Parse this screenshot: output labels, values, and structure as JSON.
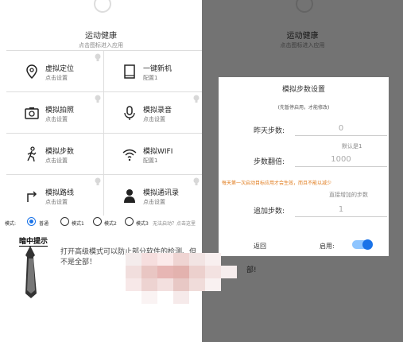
{
  "app": {
    "title": "运动健康",
    "subtitle": "点击图标进入应用"
  },
  "grid": [
    {
      "label": "虚拟定位",
      "status": "点击设置",
      "icon": "location-pin-icon"
    },
    {
      "label": "一键新机",
      "status": "配置1",
      "icon": "tablet-icon"
    },
    {
      "label": "模拟拍照",
      "status": "点击设置",
      "icon": "camera-icon"
    },
    {
      "label": "模拟录音",
      "status": "点击设置",
      "icon": "microphone-icon"
    },
    {
      "label": "模拟步数",
      "status": "点击设置",
      "icon": "walking-icon"
    },
    {
      "label": "模拟WIFI",
      "status": "配置1",
      "icon": "wifi-icon"
    },
    {
      "label": "模拟路线",
      "status": "点击设置",
      "icon": "turn-arrow-icon"
    },
    {
      "label": "模拟通讯录",
      "status": "点击设置",
      "icon": "contact-person-icon"
    }
  ],
  "modes": {
    "label": "模式:",
    "options": [
      "普通",
      "模式1",
      "模式2",
      "模式3"
    ],
    "selected": "普通",
    "hint": "无法启动？点击这里"
  },
  "tip": {
    "title": "暗中提示",
    "text": "打开高级模式可以防止部分软件的检测、但不是全部！"
  },
  "right_partial": {
    "bottom_text": "部!"
  },
  "dialog": {
    "title": "模拟步数设置",
    "note": "(先暂停启用，才能修改)",
    "yesterday_label": "昨天步数:",
    "yesterday_value": "0",
    "default_hint": "默认是1",
    "multiplier_label": "步数翻倍:",
    "multiplier_value": "1000",
    "warning": "每天第一次启动目标应用才会生效，而且不能以减少",
    "extra_hint": "直接增加的步数",
    "extra_label": "追加步数:",
    "extra_value": "1",
    "back_label": "返回",
    "enable_label": "启用:",
    "enabled": true
  },
  "colors": {
    "accent": "#1a73e8",
    "warning": "#e07a1a",
    "bulb_on": "#f2b233",
    "bulb_off": "#d8d8d8"
  }
}
